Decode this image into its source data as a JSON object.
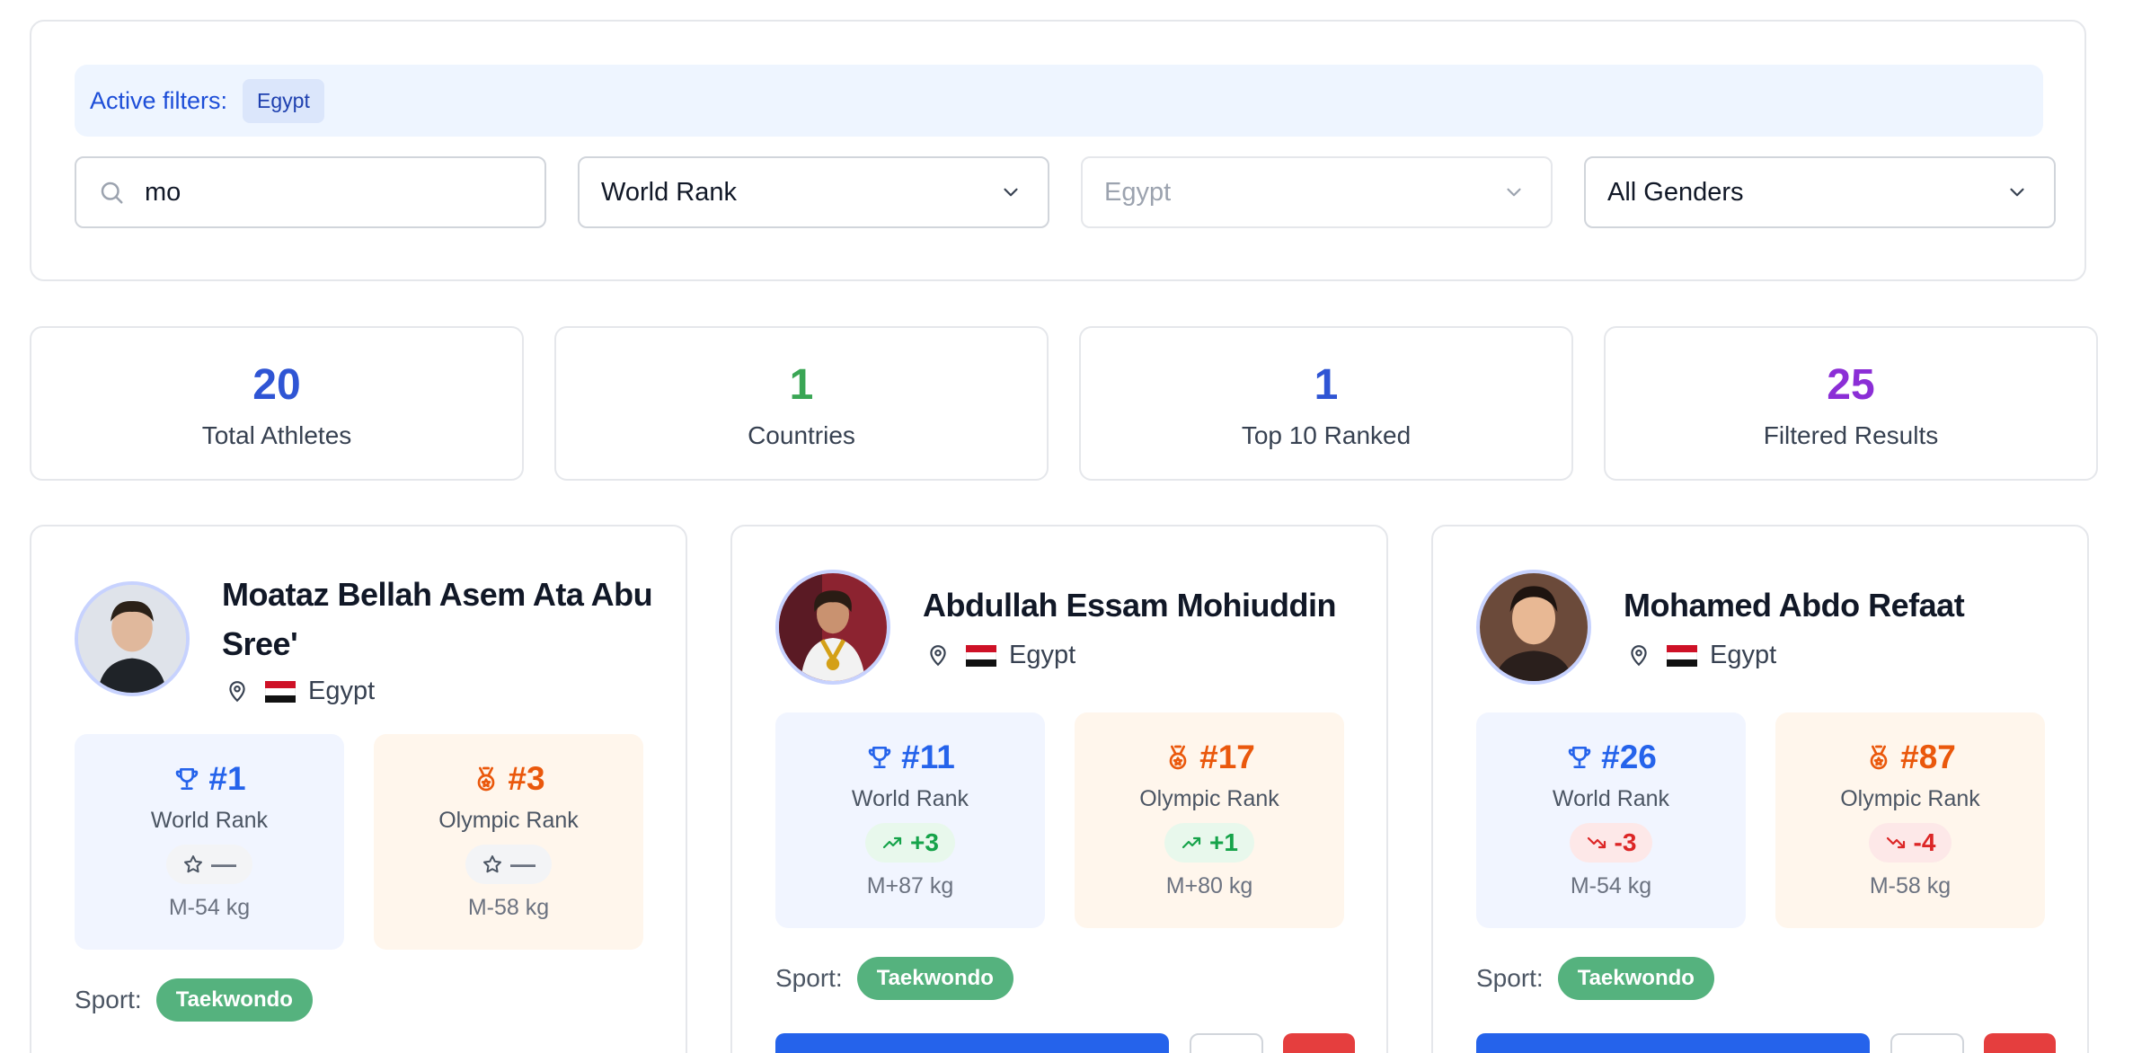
{
  "filters": {
    "active_label": "Active filters:",
    "active_chips": [
      "Egypt"
    ],
    "search_value": "mo",
    "sort_value": "World Rank",
    "country_value": "Egypt",
    "gender_value": "All Genders"
  },
  "stats": [
    {
      "value": "20",
      "label": "Total Athletes",
      "color": "#2f55d4"
    },
    {
      "value": "1",
      "label": "Countries",
      "color": "#3aa655"
    },
    {
      "value": "1",
      "label": "Top 10 Ranked",
      "color": "#2f55d4"
    },
    {
      "value": "25",
      "label": "Filtered Results",
      "color": "#8b2ed6"
    }
  ],
  "sport_label": "Sport:",
  "athletes": [
    {
      "name_line1": "Moataz Bellah Asem Ata Abu",
      "name_line2": "Sree'",
      "country": "Egypt",
      "world_rank": "#1",
      "world_label": "World Rank",
      "world_change": "—",
      "world_change_dir": "none",
      "world_weight": "M-54 kg",
      "olympic_rank": "#3",
      "olympic_label": "Olympic Rank",
      "olympic_change": "—",
      "olympic_change_dir": "none",
      "olympic_weight": "M-58 kg",
      "sport": "Taekwondo"
    },
    {
      "name": "Abdullah Essam Mohiuddin",
      "country": "Egypt",
      "world_rank": "#11",
      "world_label": "World Rank",
      "world_change": "+3",
      "world_change_dir": "up",
      "world_weight": "M+87 kg",
      "olympic_rank": "#17",
      "olympic_label": "Olympic Rank",
      "olympic_change": "+1",
      "olympic_change_dir": "up",
      "olympic_weight": "M+80 kg",
      "sport": "Taekwondo"
    },
    {
      "name": "Mohamed Abdo Refaat",
      "country": "Egypt",
      "world_rank": "#26",
      "world_label": "World Rank",
      "world_change": "-3",
      "world_change_dir": "down",
      "world_weight": "M-54 kg",
      "olympic_rank": "#87",
      "olympic_label": "Olympic Rank",
      "olympic_change": "-4",
      "olympic_change_dir": "down",
      "olympic_weight": "M-58 kg",
      "sport": "Taekwondo"
    }
  ]
}
